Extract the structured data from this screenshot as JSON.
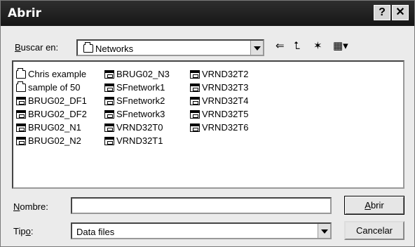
{
  "window": {
    "title": "Abrir",
    "help": "?",
    "close": "✕"
  },
  "lookin": {
    "label_under": "B",
    "label_rest": "uscar en:",
    "value": "Networks"
  },
  "toolbar": {
    "back": "⇐",
    "up": "⮤",
    "newfolder": "✶",
    "view": "▦▾"
  },
  "files": {
    "col1": [
      {
        "name": "Chris example",
        "type": "folder"
      },
      {
        "name": "sample of 50",
        "type": "folder"
      },
      {
        "name": "BRUG02_DF1",
        "type": "file"
      },
      {
        "name": "BRUG02_DF2",
        "type": "file"
      },
      {
        "name": "BRUG02_N1",
        "type": "file"
      },
      {
        "name": "BRUG02_N2",
        "type": "file"
      }
    ],
    "col2": [
      {
        "name": "BRUG02_N3",
        "type": "file"
      },
      {
        "name": "SFnetwork1",
        "type": "file"
      },
      {
        "name": "SFnetwork2",
        "type": "file"
      },
      {
        "name": "SFnetwork3",
        "type": "file"
      },
      {
        "name": "VRND32T0",
        "type": "file"
      },
      {
        "name": "VRND32T1",
        "type": "file"
      }
    ],
    "col3": [
      {
        "name": "VRND32T2",
        "type": "file"
      },
      {
        "name": "VRND32T3",
        "type": "file"
      },
      {
        "name": "VRND32T4",
        "type": "file"
      },
      {
        "name": "VRND32T5",
        "type": "file"
      },
      {
        "name": "VRND32T6",
        "type": "file"
      }
    ]
  },
  "name_field": {
    "label_under": "N",
    "label_rest": "ombre:",
    "value": ""
  },
  "type_field": {
    "label_pre": "Tip",
    "label_under": "o",
    "label_rest": ":",
    "value": "Data files"
  },
  "buttons": {
    "open": "Abrir",
    "open_under": "A",
    "open_rest": "brir",
    "cancel": "Cancelar"
  }
}
